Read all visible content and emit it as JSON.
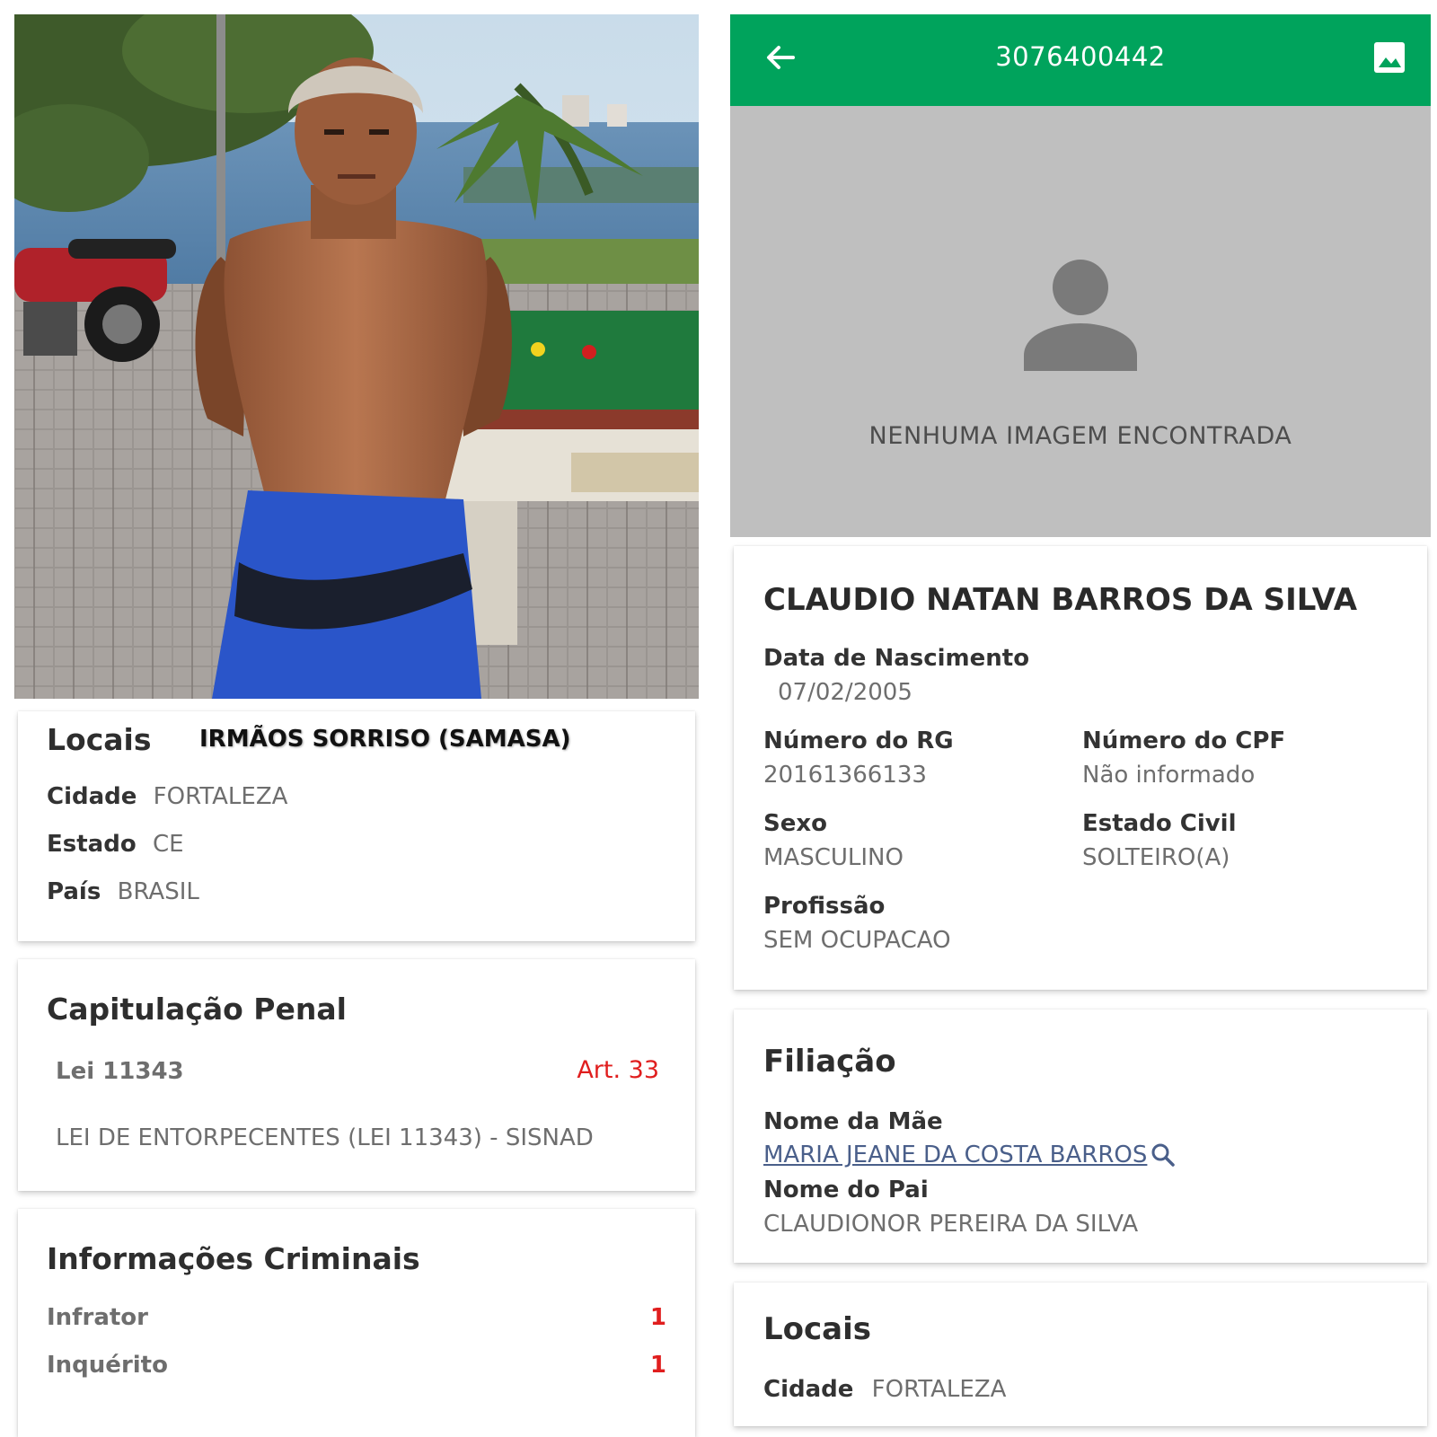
{
  "left": {
    "locais_card": {
      "title": "Locais",
      "overlay_caption": "IRMÃOS SORRISO (SAMASA)",
      "rows": [
        {
          "label": "Cidade",
          "value": "FORTALEZA"
        },
        {
          "label": "Estado",
          "value": "CE"
        },
        {
          "label": "País",
          "value": "BRASIL"
        }
      ]
    },
    "capitulacao": {
      "title": "Capitulação Penal",
      "lei": "Lei 11343",
      "artigo": "Art. 33",
      "descricao": "LEI DE ENTORPECENTES (LEI 11343) - SISNAD"
    },
    "informacoes": {
      "title": "Informações Criminais",
      "rows": [
        {
          "label": "Infrator",
          "value": "1"
        },
        {
          "label": "Inquérito",
          "value": "1"
        }
      ]
    }
  },
  "right": {
    "appbar": {
      "title": "3076400442"
    },
    "no_image": {
      "message": "NENHUMA IMAGEM ENCONTRADA"
    },
    "person": {
      "name": "CLAUDIO NATAN BARROS DA SILVA",
      "nascimento_label": "Data de Nascimento",
      "nascimento_value": "07/02/2005",
      "rg_label": "Número do RG",
      "rg_value": "20161366133",
      "cpf_label": "Número do CPF",
      "cpf_value": "Não informado",
      "sexo_label": "Sexo",
      "sexo_value": "MASCULINO",
      "civil_label": "Estado Civil",
      "civil_value": "SOLTEIRO(A)",
      "profissao_label": "Profissão",
      "profissao_value": "SEM OCUPACAO"
    },
    "filiacao": {
      "title": "Filiação",
      "mae_label": "Nome da Mãe",
      "mae_value": "MARIA JEANE DA COSTA BARROS",
      "pai_label": "Nome do Pai",
      "pai_value": "CLAUDIONOR PEREIRA DA SILVA"
    },
    "locais": {
      "title": "Locais",
      "cidade_label": "Cidade",
      "cidade_value": "FORTALEZA"
    }
  },
  "colors": {
    "appbar_green": "#00a35c",
    "accent_red": "#e01e1e",
    "link_blue": "#4a5f8a",
    "placeholder_gray": "#bfbfbf"
  }
}
